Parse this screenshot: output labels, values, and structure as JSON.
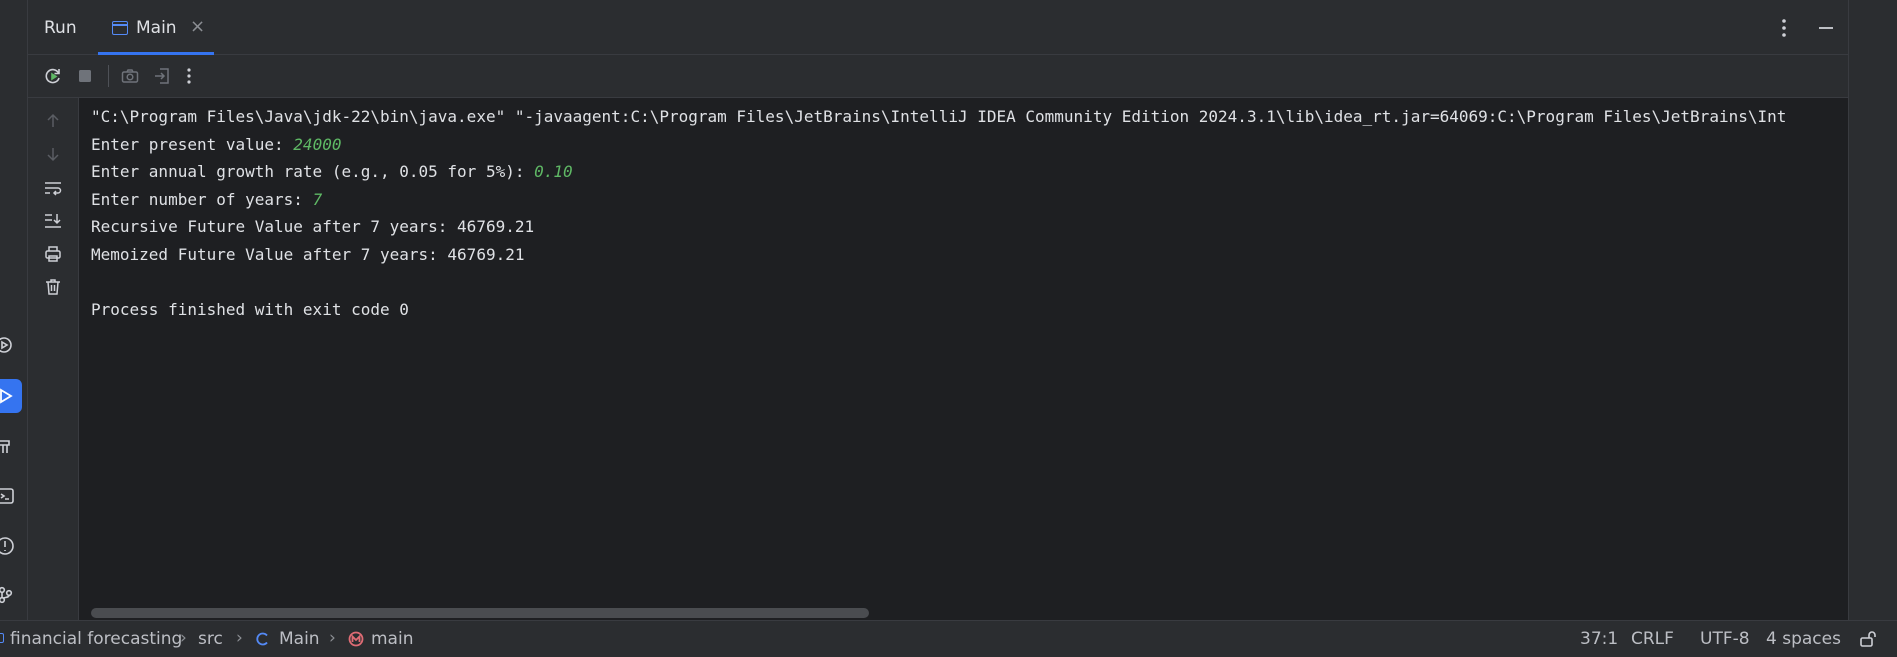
{
  "run_panel": {
    "title": "Run",
    "tab": {
      "label": "Main",
      "close": "×"
    }
  },
  "console": {
    "lines": [
      {
        "text": "\"C:\\Program Files\\Java\\jdk-22\\bin\\java.exe\" \"-javaagent:C:\\Program Files\\JetBrains\\IntelliJ IDEA Community Edition 2024.3.1\\lib\\idea_rt.jar=64069:C:\\Program Files\\JetBrains\\Int",
        "input": ""
      },
      {
        "text": "Enter present value: ",
        "input": "24000"
      },
      {
        "text": "Enter annual growth rate (e.g., 0.05 for 5%): ",
        "input": "0.10"
      },
      {
        "text": "Enter number of years: ",
        "input": "7"
      },
      {
        "text": "Recursive Future Value after 7 years: 46769.21",
        "input": ""
      },
      {
        "text": "Memoized Future Value after 7 years: 46769.21",
        "input": ""
      },
      {
        "text": "",
        "input": ""
      },
      {
        "text": "Process finished with exit code 0",
        "input": ""
      }
    ]
  },
  "breadcrumb": {
    "project": "financial forecasting",
    "folder": "src",
    "class": "Main",
    "method": "main",
    "separator": "›"
  },
  "status": {
    "position": "37:1",
    "line_ending": "CRLF",
    "encoding": "UTF-8",
    "indent": "4 spaces"
  },
  "icons": {
    "toolbar": [
      "rerun-icon",
      "stop-icon",
      "camera-icon",
      "exit-icon",
      "more-vertical-icon"
    ],
    "gutter": [
      "arrow-up-icon",
      "arrow-down-icon",
      "soft-wrap-icon",
      "scroll-to-end-icon",
      "print-icon",
      "trash-icon"
    ],
    "tool_window": [
      "services-icon",
      "run-icon",
      "build-icon",
      "terminal-icon",
      "problems-icon",
      "git-icon"
    ]
  },
  "colors": {
    "background": "#1e1f22",
    "panel": "#2b2d30",
    "accent": "#3574f0",
    "user_input": "#5fb865",
    "text": "#dfe1e5"
  }
}
